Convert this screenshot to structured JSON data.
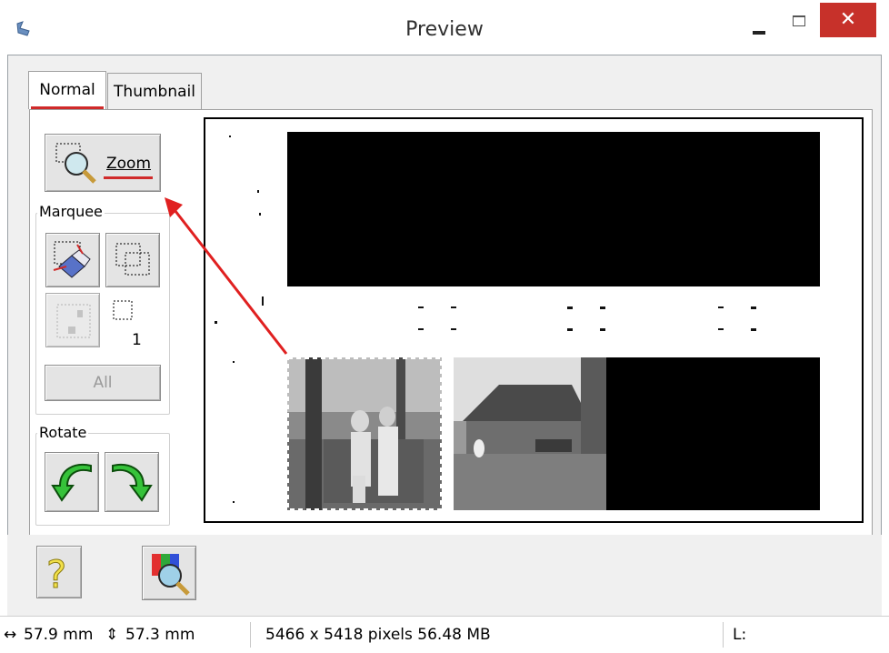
{
  "window": {
    "title": "Preview",
    "close_glyph": "✕",
    "accent_color": "#d02a2a",
    "close_color": "#c7312a"
  },
  "tabs": [
    {
      "label": "Normal",
      "active": true
    },
    {
      "label": "Thumbnail",
      "active": false
    }
  ],
  "toolbar": {
    "zoom_label": "Zoom",
    "marquee_label": "Marquee",
    "marquee_count": "1",
    "all_label": "All",
    "rotate_label": "Rotate"
  },
  "icons": {
    "app": "scanner-app-icon",
    "zoom": "magnifier-icon",
    "erase_marquee": "eraser-icon",
    "duplicate_marquee": "duplicate-marquee-icon",
    "auto_locate": "auto-locate-icon",
    "marquee_indicator": "dashed-square-icon",
    "rotate_left": "rotate-left-arrow-icon",
    "rotate_right": "rotate-right-arrow-icon",
    "help": "question-mark-icon",
    "color_palette": "color-palette-icon"
  },
  "status": {
    "width_symbol": "↔",
    "width_value": "57.9 mm",
    "height_symbol": "⇕",
    "height_value": "57.3 mm",
    "pixels": "5466 x 5418 pixels 56.48 MB",
    "lightness": "L:"
  }
}
